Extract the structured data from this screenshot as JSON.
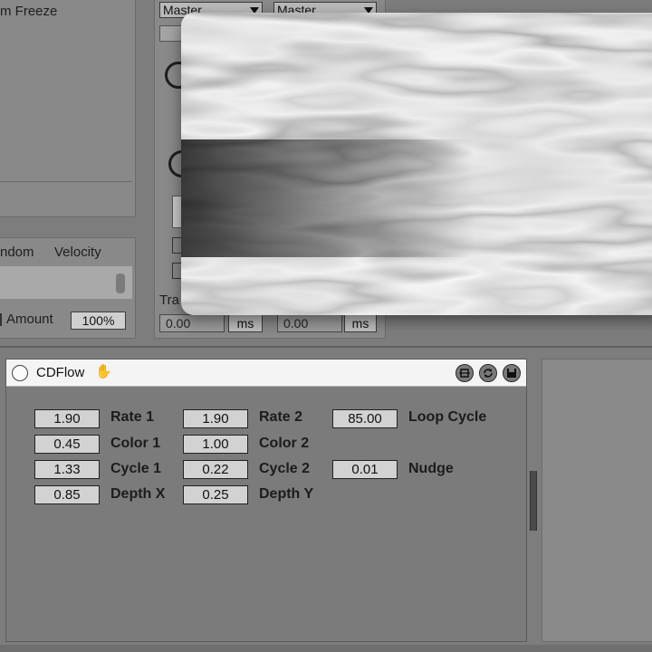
{
  "background_panels": {
    "freeze_label": "m Freeze",
    "random_label": "ndom",
    "velocity_label": "Velocity",
    "amount_label": "Amount",
    "amount_value": "100%",
    "dropdown_1": "Master",
    "dropdown_2": "Master",
    "tra_label": "Tra",
    "delay_left_value": "0.00",
    "delay_left_unit": "ms",
    "delay_right_value": "0.00",
    "delay_right_unit": "ms"
  },
  "plugin": {
    "title": "CDFlow",
    "params": [
      {
        "id": "rate1",
        "value": "1.90",
        "label": "Rate 1"
      },
      {
        "id": "rate2",
        "value": "1.90",
        "label": "Rate 2"
      },
      {
        "id": "loopcycle",
        "value": "85.00",
        "label": "Loop Cycle"
      },
      {
        "id": "color1",
        "value": "0.45",
        "label": "Color 1"
      },
      {
        "id": "color2",
        "value": "1.00",
        "label": "Color 2"
      },
      {
        "id": "cycle1",
        "value": "1.33",
        "label": "Cycle 1"
      },
      {
        "id": "cycle2",
        "value": "0.22",
        "label": "Cycle 2"
      },
      {
        "id": "nudge",
        "value": "0.01",
        "label": "Nudge"
      },
      {
        "id": "depthx",
        "value": "0.85",
        "label": "Depth X"
      },
      {
        "id": "depthy",
        "value": "0.25",
        "label": "Depth Y"
      }
    ],
    "title_icons": [
      "fit-icon",
      "refresh-icon",
      "save-icon"
    ]
  },
  "colors": {
    "app_background": "#7d7d7d",
    "panel": "#898989",
    "title_bar": "#f4f4f4",
    "field": "#d2d2d2"
  }
}
